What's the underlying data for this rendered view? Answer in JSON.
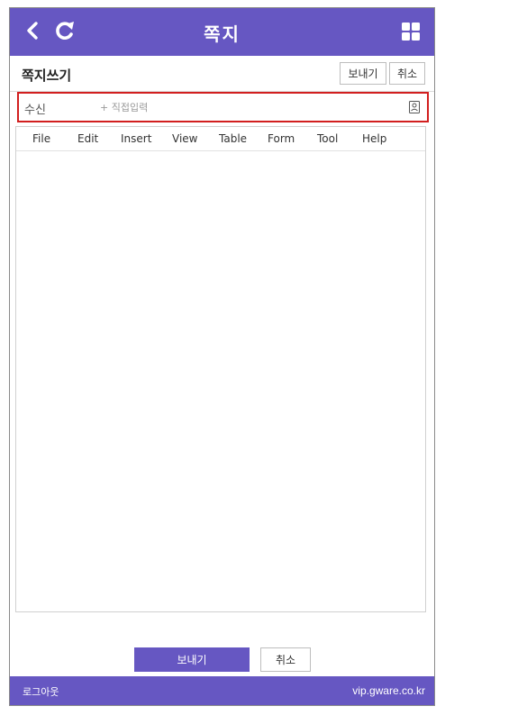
{
  "header": {
    "title": "쪽지",
    "icons": {
      "back": "chevron-left-icon",
      "refresh": "refresh-icon",
      "menu": "grid-menu-icon"
    }
  },
  "compose": {
    "title": "쪽지쓰기",
    "send_label": "보내기",
    "cancel_label": "취소"
  },
  "recipient": {
    "label": "수신",
    "placeholder": "+ 직접입력",
    "value": "",
    "icon": "address-book-icon"
  },
  "editor": {
    "menu": [
      "File",
      "Edit",
      "Insert",
      "View",
      "Table",
      "Form",
      "Tool",
      "Help"
    ],
    "content": ""
  },
  "actions": {
    "send_label": "보내기",
    "cancel_label": "취소"
  },
  "footer": {
    "logout_label": "로그아웃",
    "domain": "vip.gware.co.kr"
  },
  "colors": {
    "brand": "#6657c2",
    "highlight_border": "#d21f1f"
  }
}
